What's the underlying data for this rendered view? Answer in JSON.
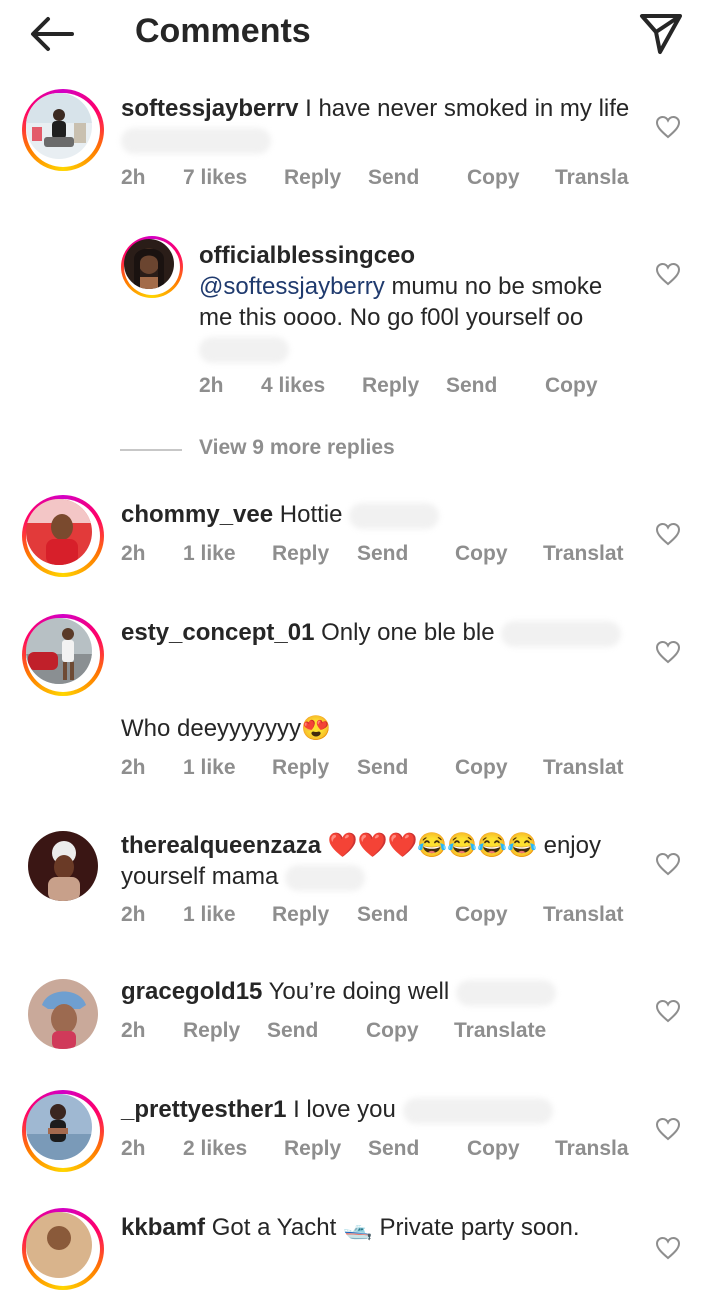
{
  "header": {
    "title": "Comments",
    "back_icon": "arrow-left-icon",
    "share_icon": "paper-plane-icon"
  },
  "comments": [
    {
      "username": "softessjayberrv",
      "text": "I have never smoked in my life",
      "time": "2h",
      "likes": "7 likes",
      "reply": "Reply",
      "send": "Send",
      "copy": "Copy",
      "translate": "Transla"
    },
    {
      "username": "officialblessingceo",
      "mention": "@softessjayberry",
      "text": "mumu no be smoke me this oooo. No go f00l yourself oo",
      "time": "2h",
      "likes": "4 likes",
      "reply": "Reply",
      "send": "Send",
      "copy": "Copy"
    },
    {
      "username": "chommy_vee",
      "text": "Hottie",
      "time": "2h",
      "likes": "1 like",
      "reply": "Reply",
      "send": "Send",
      "copy": "Copy",
      "translate": "Translat"
    },
    {
      "username": "esty_concept_01",
      "text": "Only one ble ble",
      "text2": "Who deeyyyyyyy",
      "time": "2h",
      "likes": "1 like",
      "reply": "Reply",
      "send": "Send",
      "copy": "Copy",
      "translate": "Translat"
    },
    {
      "username": "therealqueenzaza",
      "text": "enjoy yourself mama",
      "time": "2h",
      "likes": "1 like",
      "reply": "Reply",
      "send": "Send",
      "copy": "Copy",
      "translate": "Translat"
    },
    {
      "username": "gracegold15",
      "text": "You’re doing well",
      "time": "2h",
      "reply": "Reply",
      "send": "Send",
      "copy": "Copy",
      "translate": "Translate"
    },
    {
      "username": "_prettyesther1",
      "text": "I love you",
      "time": "2h",
      "likes": "2 likes",
      "reply": "Reply",
      "send": "Send",
      "copy": "Copy",
      "translate": "Transla"
    },
    {
      "username": "kkbamf",
      "text": "Got a Yacht 🛥️ Private party soon."
    }
  ],
  "view_more": "View 9 more replies",
  "colors": {
    "text": "#262626",
    "secondary": "#8e8e8e",
    "mention": "#1f3a6e",
    "story_ring": "#ff0069"
  }
}
